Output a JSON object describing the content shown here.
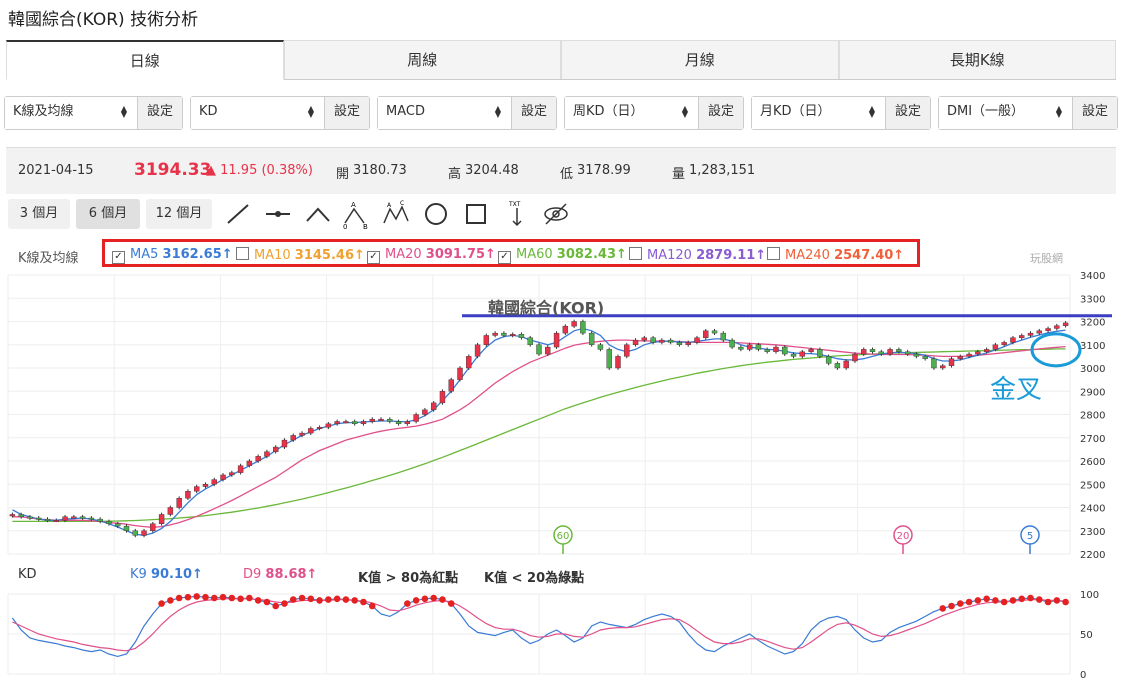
{
  "page": {
    "title": "韓國綜合(KOR) 技術分析"
  },
  "tabs": [
    {
      "label": "日線",
      "active": true
    },
    {
      "label": "周線",
      "active": false
    },
    {
      "label": "月線",
      "active": false
    },
    {
      "label": "長期K線",
      "active": false
    }
  ],
  "selectors": [
    {
      "value": "K線及均線",
      "button": "設定"
    },
    {
      "value": "KD",
      "button": "設定"
    },
    {
      "value": "MACD",
      "button": "設定"
    },
    {
      "value": "周KD（日）",
      "button": "設定"
    },
    {
      "value": "月KD（日）",
      "button": "設定"
    },
    {
      "value": "DMI（一般）",
      "button": "設定"
    }
  ],
  "quote": {
    "date": "2021-04-15",
    "price": "3194.33",
    "change": "▲ 11.95 (0.38%)",
    "open_label": "開",
    "open": "3180.73",
    "high_label": "高",
    "high": "3204.48",
    "low_label": "低",
    "low": "3178.99",
    "vol_label": "量",
    "vol": "1,283,151"
  },
  "periods": [
    {
      "label": "3 個月",
      "active": false
    },
    {
      "label": "6 個月",
      "active": true
    },
    {
      "label": "12 個月",
      "active": false
    }
  ],
  "tools": [
    "line-tool-icon",
    "horizontal-line-icon",
    "angle-tool-icon",
    "abc-pattern-icon",
    "abcd-pattern-icon",
    "circle-tool-icon",
    "rectangle-tool-icon",
    "text-tool-icon",
    "hide-eye-icon"
  ],
  "tool_labels": {
    "a": "A",
    "b": "B",
    "c": "C",
    "zero": "0",
    "txt": "TXT"
  },
  "ma_section": {
    "label": "K線及均線",
    "items": [
      {
        "name": "MA5",
        "value": "3162.65↑",
        "checked": true,
        "color": "#3a7bd5"
      },
      {
        "name": "MA10",
        "value": "3145.46↑",
        "checked": false,
        "color": "#f0a030"
      },
      {
        "name": "MA20",
        "value": "3091.75↑",
        "checked": true,
        "color": "#e0508a"
      },
      {
        "name": "MA60",
        "value": "3082.43↑",
        "checked": true,
        "color": "#6ab83a"
      },
      {
        "name": "MA120",
        "value": "2879.11↑",
        "checked": false,
        "color": "#8a5cd0"
      },
      {
        "name": "MA240",
        "value": "2547.40↑",
        "checked": false,
        "color": "#f0603a"
      }
    ]
  },
  "watermark": "玩股網",
  "annotation": {
    "chart_name": "韓國綜合(KOR)",
    "golden_cross": "金叉"
  },
  "chart_data": [
    {
      "type": "candlestick",
      "title": "韓國綜合(KOR)",
      "ylim": [
        2200,
        3400
      ],
      "y_ticks": [
        "3400",
        "3300",
        "3200",
        "3100",
        "3000",
        "2900",
        "2800",
        "2700",
        "2600",
        "2500",
        "2400",
        "2300",
        "2200"
      ],
      "resistance_level": 3225,
      "ma_markers": [
        "60",
        "20",
        "5"
      ],
      "close": [
        2370,
        2360,
        2355,
        2350,
        2345,
        2345,
        2360,
        2360,
        2355,
        2350,
        2340,
        2330,
        2320,
        2300,
        2280,
        2300,
        2330,
        2370,
        2400,
        2440,
        2470,
        2490,
        2500,
        2520,
        2540,
        2550,
        2580,
        2600,
        2620,
        2640,
        2660,
        2690,
        2710,
        2720,
        2740,
        2745,
        2760,
        2770,
        2770,
        2760,
        2770,
        2780,
        2780,
        2770,
        2760,
        2770,
        2800,
        2820,
        2850,
        2900,
        2950,
        3000,
        3050,
        3100,
        3140,
        3150,
        3140,
        3145,
        3130,
        3100,
        3060,
        3090,
        3150,
        3180,
        3200,
        3150,
        3100,
        3080,
        3000,
        3050,
        3100,
        3120,
        3130,
        3110,
        3120,
        3110,
        3100,
        3110,
        3130,
        3160,
        3150,
        3120,
        3090,
        3080,
        3100,
        3080,
        3070,
        3090,
        3060,
        3050,
        3070,
        3080,
        3050,
        3020,
        3000,
        3030,
        3060,
        3080,
        3070,
        3060,
        3080,
        3070,
        3060,
        3050,
        3040,
        3000,
        3010,
        3040,
        3050,
        3060,
        3070,
        3080,
        3100,
        3110,
        3130,
        3140,
        3150,
        3160,
        3170,
        3182,
        3194
      ],
      "ma5": [
        2390,
        2370,
        2360,
        2350,
        2345,
        2345,
        2350,
        2352,
        2355,
        2350,
        2342,
        2330,
        2316,
        2300,
        2285,
        2280,
        2290,
        2310,
        2340,
        2380,
        2420,
        2455,
        2480,
        2500,
        2520,
        2540,
        2560,
        2580,
        2600,
        2620,
        2645,
        2670,
        2690,
        2710,
        2725,
        2740,
        2750,
        2760,
        2765,
        2765,
        2768,
        2770,
        2772,
        2772,
        2770,
        2768,
        2778,
        2795,
        2820,
        2860,
        2900,
        2950,
        3000,
        3050,
        3090,
        3120,
        3135,
        3140,
        3135,
        3120,
        3110,
        3100,
        3110,
        3135,
        3160,
        3170,
        3160,
        3140,
        3100,
        3080,
        3070,
        3080,
        3100,
        3110,
        3115,
        3115,
        3112,
        3110,
        3115,
        3120,
        3125,
        3125,
        3115,
        3100,
        3090,
        3085,
        3080,
        3078,
        3072,
        3065,
        3062,
        3062,
        3058,
        3050,
        3040,
        3035,
        3035,
        3040,
        3050,
        3060,
        3065,
        3068,
        3065,
        3062,
        3055,
        3040,
        3030,
        3030,
        3035,
        3045,
        3055,
        3065,
        3078,
        3092,
        3108,
        3120,
        3132,
        3142,
        3152,
        3158,
        3163
      ],
      "ma20": [
        2360,
        2360,
        2355,
        2350,
        2348,
        2345,
        2345,
        2345,
        2345,
        2343,
        2340,
        2336,
        2332,
        2328,
        2322,
        2318,
        2315,
        2318,
        2325,
        2335,
        2348,
        2362,
        2378,
        2395,
        2412,
        2430,
        2450,
        2470,
        2490,
        2510,
        2530,
        2555,
        2580,
        2605,
        2625,
        2645,
        2660,
        2675,
        2690,
        2700,
        2710,
        2720,
        2728,
        2735,
        2740,
        2745,
        2750,
        2758,
        2768,
        2780,
        2800,
        2820,
        2845,
        2875,
        2905,
        2935,
        2960,
        2985,
        3005,
        3025,
        3040,
        3055,
        3070,
        3085,
        3098,
        3105,
        3110,
        3115,
        3118,
        3120,
        3120,
        3118,
        3116,
        3116,
        3116,
        3115,
        3114,
        3112,
        3110,
        3110,
        3110,
        3110,
        3110,
        3108,
        3106,
        3104,
        3102,
        3100,
        3096,
        3092,
        3088,
        3084,
        3080,
        3076,
        3072,
        3068,
        3064,
        3062,
        3060,
        3058,
        3058,
        3058,
        3058,
        3056,
        3055,
        3052,
        3050,
        3050,
        3050,
        3052,
        3055,
        3058,
        3062,
        3066,
        3070,
        3074,
        3078,
        3082,
        3086,
        3089,
        3092
      ],
      "ma60": [
        2340,
        2340,
        2340,
        2340,
        2340,
        2340,
        2340,
        2340,
        2340,
        2340,
        2340,
        2341,
        2342,
        2343,
        2344,
        2346,
        2348,
        2350,
        2352,
        2355,
        2358,
        2361,
        2365,
        2370,
        2375,
        2380,
        2386,
        2392,
        2398,
        2405,
        2412,
        2420,
        2428,
        2436,
        2445,
        2454,
        2464,
        2474,
        2484,
        2494,
        2505,
        2516,
        2527,
        2538,
        2550,
        2562,
        2575,
        2588,
        2602,
        2616,
        2630,
        2645,
        2660,
        2675,
        2690,
        2705,
        2720,
        2735,
        2750,
        2765,
        2780,
        2795,
        2810,
        2825,
        2838,
        2850,
        2862,
        2874,
        2885,
        2896,
        2906,
        2916,
        2926,
        2935,
        2944,
        2953,
        2961,
        2969,
        2977,
        2984,
        2991,
        2998,
        3004,
        3010,
        3015,
        3020,
        3025,
        3029,
        3033,
        3037,
        3040,
        3043,
        3046,
        3049,
        3052,
        3054,
        3056,
        3058,
        3060,
        3062,
        3064,
        3065,
        3066,
        3067,
        3068,
        3069,
        3070,
        3071,
        3072,
        3073,
        3074,
        3075,
        3076,
        3077,
        3078,
        3079,
        3079,
        3080,
        3081,
        3082,
        3082
      ]
    },
    {
      "type": "line",
      "ylim": [
        0,
        100
      ],
      "y_ticks": [
        "100",
        "50",
        "0"
      ],
      "header": {
        "label": "KD",
        "k_label": "K9",
        "k_value": "90.10↑",
        "d_label": "D9",
        "d_value": "88.68↑",
        "rule_red": "K值 > 80為紅點",
        "rule_green": "K值 < 20為綠點"
      },
      "series": [
        {
          "name": "K9",
          "values": [
            70,
            55,
            45,
            42,
            40,
            38,
            35,
            33,
            30,
            28,
            30,
            25,
            22,
            25,
            40,
            60,
            75,
            88,
            92,
            95,
            96,
            97,
            96,
            95,
            96,
            95,
            94,
            95,
            92,
            90,
            85,
            88,
            93,
            95,
            94,
            92,
            93,
            94,
            93,
            92,
            90,
            85,
            75,
            72,
            78,
            88,
            92,
            94,
            95,
            93,
            88,
            75,
            60,
            52,
            50,
            48,
            52,
            55,
            45,
            38,
            42,
            50,
            55,
            48,
            40,
            45,
            60,
            65,
            62,
            60,
            58,
            62,
            68,
            72,
            75,
            72,
            65,
            50,
            38,
            30,
            28,
            35,
            40,
            45,
            50,
            42,
            35,
            30,
            25,
            28,
            38,
            55,
            65,
            70,
            72,
            68,
            55,
            45,
            40,
            42,
            52,
            58,
            62,
            66,
            72,
            78,
            82,
            85,
            88,
            90,
            92,
            94,
            92,
            90,
            92,
            94,
            95,
            93,
            90,
            92,
            90
          ]
        },
        {
          "name": "D9",
          "values": [
            65,
            60,
            55,
            50,
            47,
            44,
            42,
            40,
            37,
            35,
            33,
            32,
            30,
            29,
            32,
            40,
            50,
            62,
            72,
            80,
            86,
            90,
            92,
            93,
            94,
            94,
            94,
            94,
            93,
            92,
            90,
            89,
            90,
            92,
            92,
            92,
            92,
            93,
            93,
            92,
            91,
            89,
            85,
            80,
            79,
            82,
            86,
            89,
            91,
            92,
            90,
            85,
            78,
            70,
            63,
            58,
            56,
            56,
            53,
            48,
            46,
            47,
            50,
            50,
            47,
            46,
            50,
            55,
            57,
            58,
            58,
            59,
            62,
            65,
            68,
            69,
            68,
            62,
            54,
            46,
            40,
            38,
            38,
            40,
            44,
            44,
            41,
            37,
            33,
            31,
            33,
            40,
            48,
            56,
            62,
            64,
            61,
            56,
            50,
            47,
            48,
            51,
            55,
            59,
            63,
            68,
            73,
            77,
            81,
            84,
            87,
            89,
            90,
            90,
            91,
            92,
            93,
            93,
            92,
            92,
            91
          ]
        }
      ]
    }
  ]
}
